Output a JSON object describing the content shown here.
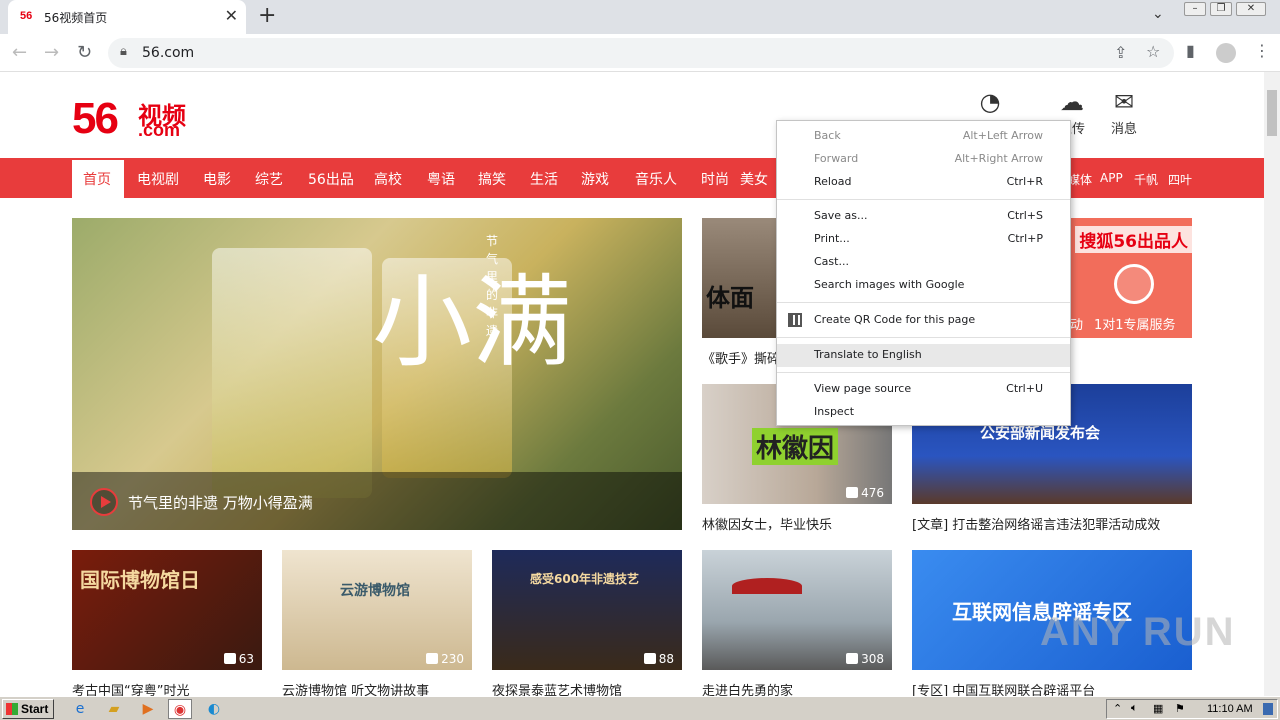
{
  "browser": {
    "tab_favicon": "56",
    "tab_title": "56视频首页",
    "tab_close": "✕",
    "new_tab": "+",
    "url": "56.com"
  },
  "site": {
    "logo_num": "56",
    "logo_cn": "视频",
    "logo_com": ".com",
    "header_icons": [
      {
        "label": ""
      },
      {
        "label": "上传"
      },
      {
        "label": "消息"
      }
    ],
    "nav": [
      "首页",
      "电视剧",
      "电影",
      "综艺",
      "56出品",
      "高校",
      "粤语",
      "搞笑",
      "生活",
      "游戏",
      "音乐人",
      "时尚",
      "美女"
    ],
    "nav_right": [
      "媒体",
      "APP",
      "千帆",
      "四叶"
    ],
    "hero": {
      "title": "节气里的非遗 万物小得盈满",
      "calligraphy": "小满",
      "vertical": "节气里的非遗"
    },
    "side_banner": "搜狐56出品人",
    "side_banner_sub": "1对1专属服务",
    "side_banner_left": "动",
    "cards_row1": [
      {
        "caption": "《歌手》撕碎",
        "thumb_text": "体面",
        "count": ""
      },
      {
        "caption": "林徽因女士，毕业快乐",
        "thumb_text": "林徽因",
        "count": "476"
      },
      {
        "caption": "[文章] 打击整治网络谣言违法犯罪活动成效",
        "thumb_text": "公安部新闻发布会",
        "count": ""
      }
    ],
    "cards_row2": [
      {
        "caption": "考古中国“穿粤”时光",
        "thumb_text": "国际博物馆日",
        "count": "63"
      },
      {
        "caption": "云游博物馆 听文物讲故事",
        "thumb_text": "云游博物馆",
        "count": "230"
      },
      {
        "caption": "夜探景泰蓝艺术博物馆",
        "thumb_text": "感受600年非遗技艺",
        "count": "88"
      },
      {
        "caption": "走进白先勇的家",
        "thumb_text": "",
        "count": "308"
      },
      {
        "caption": "[专区] 中国互联网联合辟谣平台",
        "thumb_text": "互联网信息辟谣专区",
        "count": ""
      }
    ]
  },
  "context_menu": [
    {
      "label": "Back",
      "shortcut": "Alt+Left Arrow",
      "disabled": true
    },
    {
      "label": "Forward",
      "shortcut": "Alt+Right Arrow",
      "disabled": true
    },
    {
      "label": "Reload",
      "shortcut": "Ctrl+R"
    },
    {
      "label": "Save as...",
      "shortcut": "Ctrl+S"
    },
    {
      "label": "Print...",
      "shortcut": "Ctrl+P"
    },
    {
      "label": "Cast..."
    },
    {
      "label": "Search images with Google"
    },
    {
      "label": "Create QR Code for this page"
    },
    {
      "label": "Translate to English"
    },
    {
      "label": "View page source",
      "shortcut": "Ctrl+U"
    },
    {
      "label": "Inspect"
    }
  ],
  "taskbar": {
    "start": "Start",
    "clock": "11:10 AM"
  },
  "watermark": "ANY RUN",
  "colors": {
    "brand": "#e60012",
    "nav_bg": "#e83c3c",
    "menu_highlight": "#e8e8e8"
  }
}
